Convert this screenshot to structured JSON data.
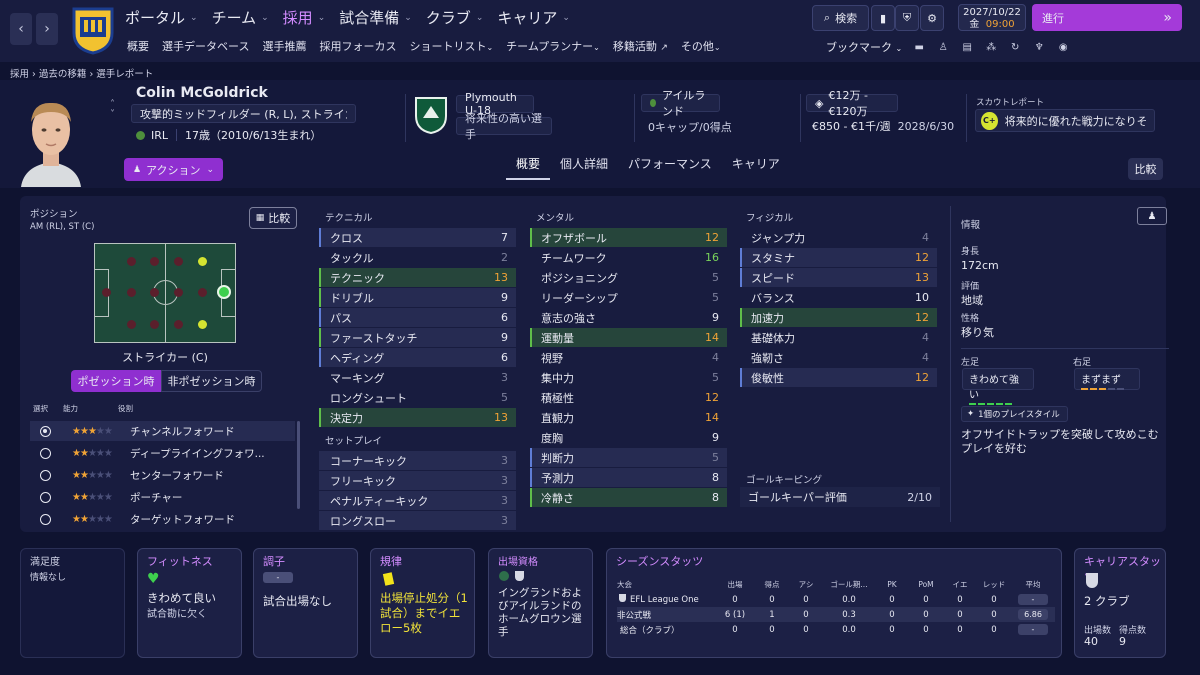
{
  "nav": {
    "main": [
      {
        "label": "ポータル",
        "active": false
      },
      {
        "label": "チーム",
        "active": false
      },
      {
        "label": "採用",
        "active": true
      },
      {
        "label": "試合準備",
        "active": false
      },
      {
        "label": "クラブ",
        "active": false
      },
      {
        "label": "キャリア",
        "active": false
      }
    ],
    "sub": [
      "概要",
      "選手データベース",
      "選手推薦",
      "採用フォーカス",
      "ショートリスト",
      "チームプランナー",
      "移籍活動",
      "その他"
    ],
    "search_label": "検索",
    "date": "2027/10/22",
    "day": "金",
    "time": "09:00",
    "advance_label": "進行",
    "bookmark_label": "ブックマーク"
  },
  "breadcrumb": [
    "採用",
    "過去の移籍",
    "選手レポート"
  ],
  "player": {
    "name": "Colin McGoldrick",
    "position_text": "攻撃的ミッドフィルダー (R, L), ストライカー (...",
    "nation_code": "IRL",
    "age_text": "17歳（2010/6/13生まれ）",
    "action_label": "アクション",
    "club": "Plymouth U-18",
    "status": "将来性の高い選手",
    "nation": "アイルランド",
    "caps": "0キャップ/0得点",
    "value": "€12万 - €120万",
    "wage": "€850 - €1千/週",
    "contract": "2028/6/30",
    "scout_label": "スカウトレポート",
    "scout_grade": "C+",
    "scout_text": "将来的に優れた戦力になりそ..."
  },
  "tabs": [
    "概要",
    "個人詳細",
    "パフォーマンス",
    "キャリア"
  ],
  "compare_label": "比較",
  "position_panel": {
    "title": "ポジション",
    "positions": "AM (RL), ST (C)",
    "compare": "比較",
    "selected_pos": "ストライカー (C)",
    "toggle_on": "ポゼッション時",
    "toggle_off": "非ポゼッション時",
    "col_select": "選択",
    "col_ability": "能力",
    "col_role": "役割",
    "roles": [
      {
        "name": "チャンネルフォワード",
        "stars": 3,
        "selected": true
      },
      {
        "name": "ディープライイングフォワ...",
        "stars": 2,
        "selected": false
      },
      {
        "name": "センターフォワード",
        "stars": 2,
        "selected": false
      },
      {
        "name": "ポーチャー",
        "stars": 2,
        "selected": false
      },
      {
        "name": "ターゲットフォワード",
        "stars": 2,
        "selected": false
      }
    ]
  },
  "attributes": {
    "technical_title": "テクニカル",
    "technical": [
      {
        "name": "クロス",
        "value": "7",
        "style": "hl",
        "bar": "#5f7dd6",
        "color": "white"
      },
      {
        "name": "タックル",
        "value": "2",
        "style": "",
        "bar": "",
        "color": "gray"
      },
      {
        "name": "テクニック",
        "value": "13",
        "style": "gr",
        "bar": "#5fbf4a",
        "color": "orange"
      },
      {
        "name": "ドリブル",
        "value": "9",
        "style": "hl",
        "bar": "#5fbf4a",
        "color": "white"
      },
      {
        "name": "パス",
        "value": "6",
        "style": "hl",
        "bar": "#5f7dd6",
        "color": "white"
      },
      {
        "name": "ファーストタッチ",
        "value": "9",
        "style": "hl",
        "bar": "#5fbf4a",
        "color": "white"
      },
      {
        "name": "ヘディング",
        "value": "6",
        "style": "hl",
        "bar": "#5f7dd6",
        "color": "white"
      },
      {
        "name": "マーキング",
        "value": "3",
        "style": "",
        "bar": "",
        "color": "gray"
      },
      {
        "name": "ロングシュート",
        "value": "5",
        "style": "",
        "bar": "",
        "color": "gray"
      },
      {
        "name": "決定力",
        "value": "13",
        "style": "gr",
        "bar": "#5fbf4a",
        "color": "orange"
      }
    ],
    "setpiece_title": "セットプレイ",
    "setpiece": [
      {
        "name": "コーナーキック",
        "value": "3",
        "color": "gray"
      },
      {
        "name": "フリーキック",
        "value": "3",
        "color": "gray"
      },
      {
        "name": "ペナルティーキック",
        "value": "3",
        "color": "gray"
      },
      {
        "name": "ロングスロー",
        "value": "3",
        "color": "gray"
      }
    ],
    "mental_title": "メンタル",
    "mental": [
      {
        "name": "オフザボール",
        "value": "12",
        "style": "gr",
        "bar": "#5fbf4a",
        "color": "orange"
      },
      {
        "name": "チームワーク",
        "value": "16",
        "style": "",
        "bar": "",
        "color": "green"
      },
      {
        "name": "ポジショニング",
        "value": "5",
        "style": "",
        "bar": "",
        "color": "gray"
      },
      {
        "name": "リーダーシップ",
        "value": "5",
        "style": "",
        "bar": "",
        "color": "gray"
      },
      {
        "name": "意志の強さ",
        "value": "9",
        "style": "",
        "bar": "",
        "color": "white"
      },
      {
        "name": "運動量",
        "value": "14",
        "style": "gr",
        "bar": "#5fbf4a",
        "color": "orange"
      },
      {
        "name": "視野",
        "value": "4",
        "style": "",
        "bar": "",
        "color": "gray"
      },
      {
        "name": "集中力",
        "value": "5",
        "style": "",
        "bar": "",
        "color": "gray"
      },
      {
        "name": "積極性",
        "value": "12",
        "style": "",
        "bar": "",
        "color": "orange"
      },
      {
        "name": "直観力",
        "value": "14",
        "style": "",
        "bar": "",
        "color": "orange"
      },
      {
        "name": "度胸",
        "value": "9",
        "style": "",
        "bar": "",
        "color": "white"
      },
      {
        "name": "判断力",
        "value": "5",
        "style": "hl",
        "bar": "#5f7dd6",
        "color": "gray"
      },
      {
        "name": "予測力",
        "value": "8",
        "style": "hl",
        "bar": "#5f7dd6",
        "color": "white"
      },
      {
        "name": "冷静さ",
        "value": "8",
        "style": "gr",
        "bar": "#5fbf4a",
        "color": "white"
      }
    ],
    "physical_title": "フィジカル",
    "physical": [
      {
        "name": "ジャンプ力",
        "value": "4",
        "style": "",
        "bar": "",
        "color": "gray"
      },
      {
        "name": "スタミナ",
        "value": "12",
        "style": "hl",
        "bar": "#5f7dd6",
        "color": "orange"
      },
      {
        "name": "スピード",
        "value": "13",
        "style": "hl",
        "bar": "#5f7dd6",
        "color": "orange"
      },
      {
        "name": "バランス",
        "value": "10",
        "style": "",
        "bar": "",
        "color": "white"
      },
      {
        "name": "加速力",
        "value": "12",
        "style": "gr",
        "bar": "#5fbf4a",
        "color": "orange"
      },
      {
        "name": "基礎体力",
        "value": "4",
        "style": "",
        "bar": "",
        "color": "gray"
      },
      {
        "name": "強靭さ",
        "value": "4",
        "style": "",
        "bar": "",
        "color": "gray"
      },
      {
        "name": "俊敏性",
        "value": "12",
        "style": "hl",
        "bar": "#5f7dd6",
        "color": "orange"
      }
    ],
    "gk_title": "ゴールキーピング",
    "gk_label": "ゴールキーパー評価",
    "gk_value": "2/10"
  },
  "info": {
    "title": "情報",
    "height_label": "身長",
    "height": "172cm",
    "rating_label": "評価",
    "rating": "地域",
    "personality_label": "性格",
    "personality": "移り気",
    "left_foot_label": "左足",
    "left_foot": "きわめて強い",
    "right_foot_label": "右足",
    "right_foot": "まずまず",
    "playstyle_label": "1個のプレイスタイル",
    "playstyle_text": "オフサイドトラップを突破して攻めこむプレイを好む"
  },
  "cards": {
    "satisfaction_title": "満足度",
    "satisfaction_text": "情報なし",
    "fitness_title": "フィットネス",
    "fitness_text": "きわめて良い",
    "fitness_sub": "試合勘に欠く",
    "form_title": "調子",
    "form_pill": "-",
    "form_text": "試合出場なし",
    "discipline_title": "規律",
    "discipline_text": "出場停止処分（1試合）までイエロー5枚",
    "eligibility_title": "出場資格",
    "eligibility_text": "イングランドおよびアイルランドのホームグロウン選手",
    "season_title": "シーズンスタッツ",
    "season_headers": [
      "大会",
      "出場",
      "得点",
      "アシ",
      "ゴール期...",
      "PK",
      "PoM",
      "イエ",
      "レッド",
      "平均"
    ],
    "season_rows": [
      [
        "EFL League One",
        "0",
        "0",
        "0",
        "0.0",
        "0",
        "0",
        "0",
        "0",
        "-"
      ],
      [
        "非公式戦",
        "6 (1)",
        "1",
        "0",
        "0.3",
        "0",
        "0",
        "0",
        "0",
        "6.86"
      ],
      [
        "総合（クラブ）",
        "0",
        "0",
        "0",
        "0.0",
        "0",
        "0",
        "0",
        "0",
        "-"
      ]
    ],
    "career_title": "キャリアスタッツ",
    "career_clubs": "2 クラブ",
    "career_apps_label": "出場数",
    "career_apps": "40",
    "career_goals_label": "得点数",
    "career_goals": "9"
  }
}
